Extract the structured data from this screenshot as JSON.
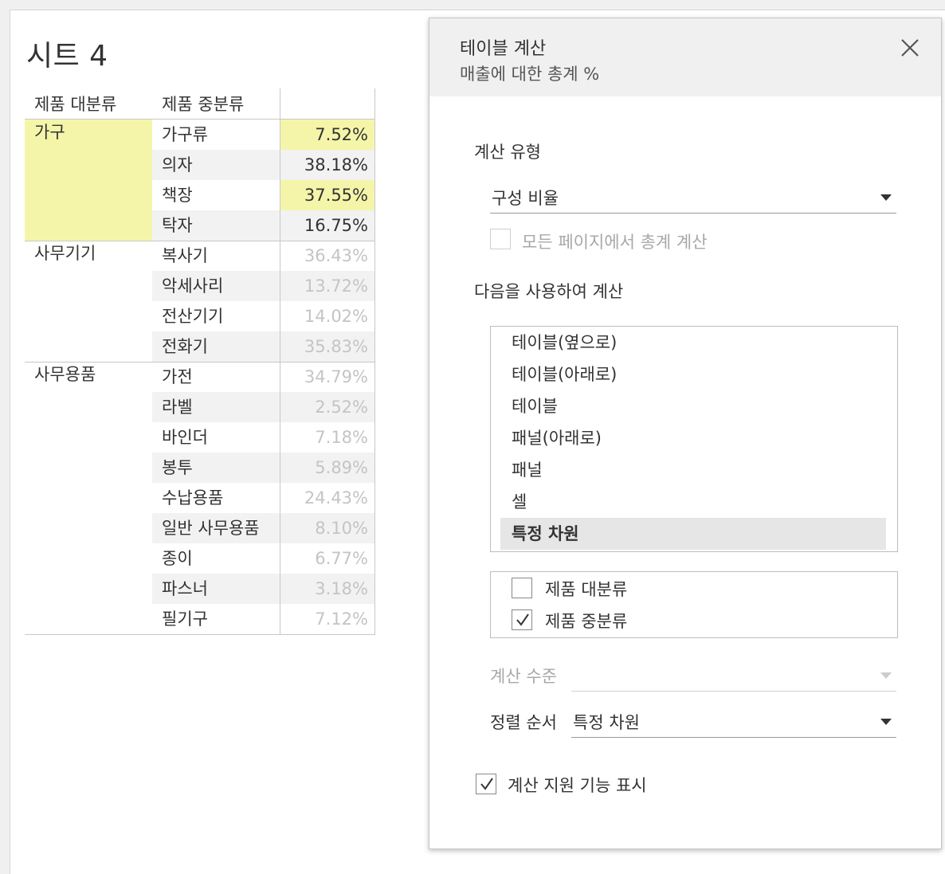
{
  "sheet": {
    "title": "시트 4"
  },
  "table": {
    "headers": {
      "category": "제품 대분류",
      "subcategory": "제품 중분류"
    },
    "groups": [
      {
        "category": "가구",
        "highlighted": true,
        "rows": [
          {
            "sub": "가구류",
            "value": "7.52%"
          },
          {
            "sub": "의자",
            "value": "38.18%"
          },
          {
            "sub": "책장",
            "value": "37.55%"
          },
          {
            "sub": "탁자",
            "value": "16.75%"
          }
        ]
      },
      {
        "category": "사무기기",
        "highlighted": false,
        "rows": [
          {
            "sub": "복사기",
            "value": "36.43%"
          },
          {
            "sub": "악세사리",
            "value": "13.72%"
          },
          {
            "sub": "전산기기",
            "value": "14.02%"
          },
          {
            "sub": "전화기",
            "value": "35.83%"
          }
        ]
      },
      {
        "category": "사무용품",
        "highlighted": false,
        "rows": [
          {
            "sub": "가전",
            "value": "34.79%"
          },
          {
            "sub": "라벨",
            "value": "2.52%"
          },
          {
            "sub": "바인더",
            "value": "7.18%"
          },
          {
            "sub": "봉투",
            "value": "5.89%"
          },
          {
            "sub": "수납용품",
            "value": "24.43%"
          },
          {
            "sub": "일반 사무용품",
            "value": "8.10%"
          },
          {
            "sub": "종이",
            "value": "6.77%"
          },
          {
            "sub": "파스너",
            "value": "3.18%"
          },
          {
            "sub": "필기구",
            "value": "7.12%"
          }
        ]
      }
    ]
  },
  "dialog": {
    "title": "테이블 계산",
    "subtitle": "매출에 대한 총계 %",
    "calc_type_label": "계산 유형",
    "calc_type_value": "구성 비율",
    "all_pages_label": "모든 페이지에서 총계 계산",
    "all_pages_checked": false,
    "compute_using_label": "다음을 사용하여 계산",
    "compute_options": [
      "테이블(옆으로)",
      "테이블(아래로)",
      "테이블",
      "패널(아래로)",
      "패널",
      "셀",
      "특정 차원"
    ],
    "compute_selected": "특정 차원",
    "dimensions": [
      {
        "label": "제품 대분류",
        "checked": false
      },
      {
        "label": "제품 중분류",
        "checked": true
      }
    ],
    "level_label": "계산 수준",
    "level_value": "",
    "sort_label": "정렬 순서",
    "sort_value": "특정 차원",
    "show_assist_label": "계산 지원 기능 표시",
    "show_assist_checked": true
  },
  "colors": {
    "highlight": "#f5f5aa",
    "selected_item": "#e6e6e6",
    "dim_text": "#c4c4c4"
  }
}
